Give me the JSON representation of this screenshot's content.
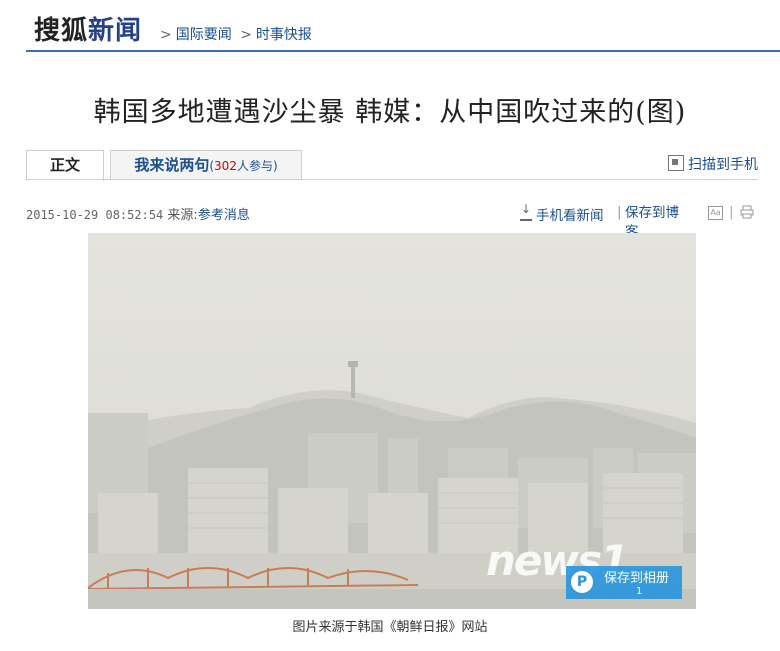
{
  "header": {
    "logo_part1": "搜狐",
    "logo_part2": "新闻",
    "breadcrumb": [
      "国际要闻",
      "时事快报"
    ],
    "breadcrumb_sep": ">"
  },
  "article": {
    "title": "韩国多地遭遇沙尘暴 韩媒：从中国吹过来的(图)",
    "tabs": {
      "main": "正文",
      "comment_label": "我来说两句",
      "comment_prefix": "(",
      "comment_count": "302",
      "comment_suffix": "人参与)"
    },
    "scan_label": "扫描到手机",
    "date": "2015-10-29 08:52:54",
    "source_label": "来源:",
    "source": "参考消息",
    "tools": {
      "mobile": "手机看新闻",
      "save_blog": "保存到博客"
    },
    "photo": {
      "watermark": "news1",
      "save_album": "保存到相册",
      "save_count": "1"
    },
    "caption": "图片来源于韩国《朝鲜日报》网站"
  }
}
